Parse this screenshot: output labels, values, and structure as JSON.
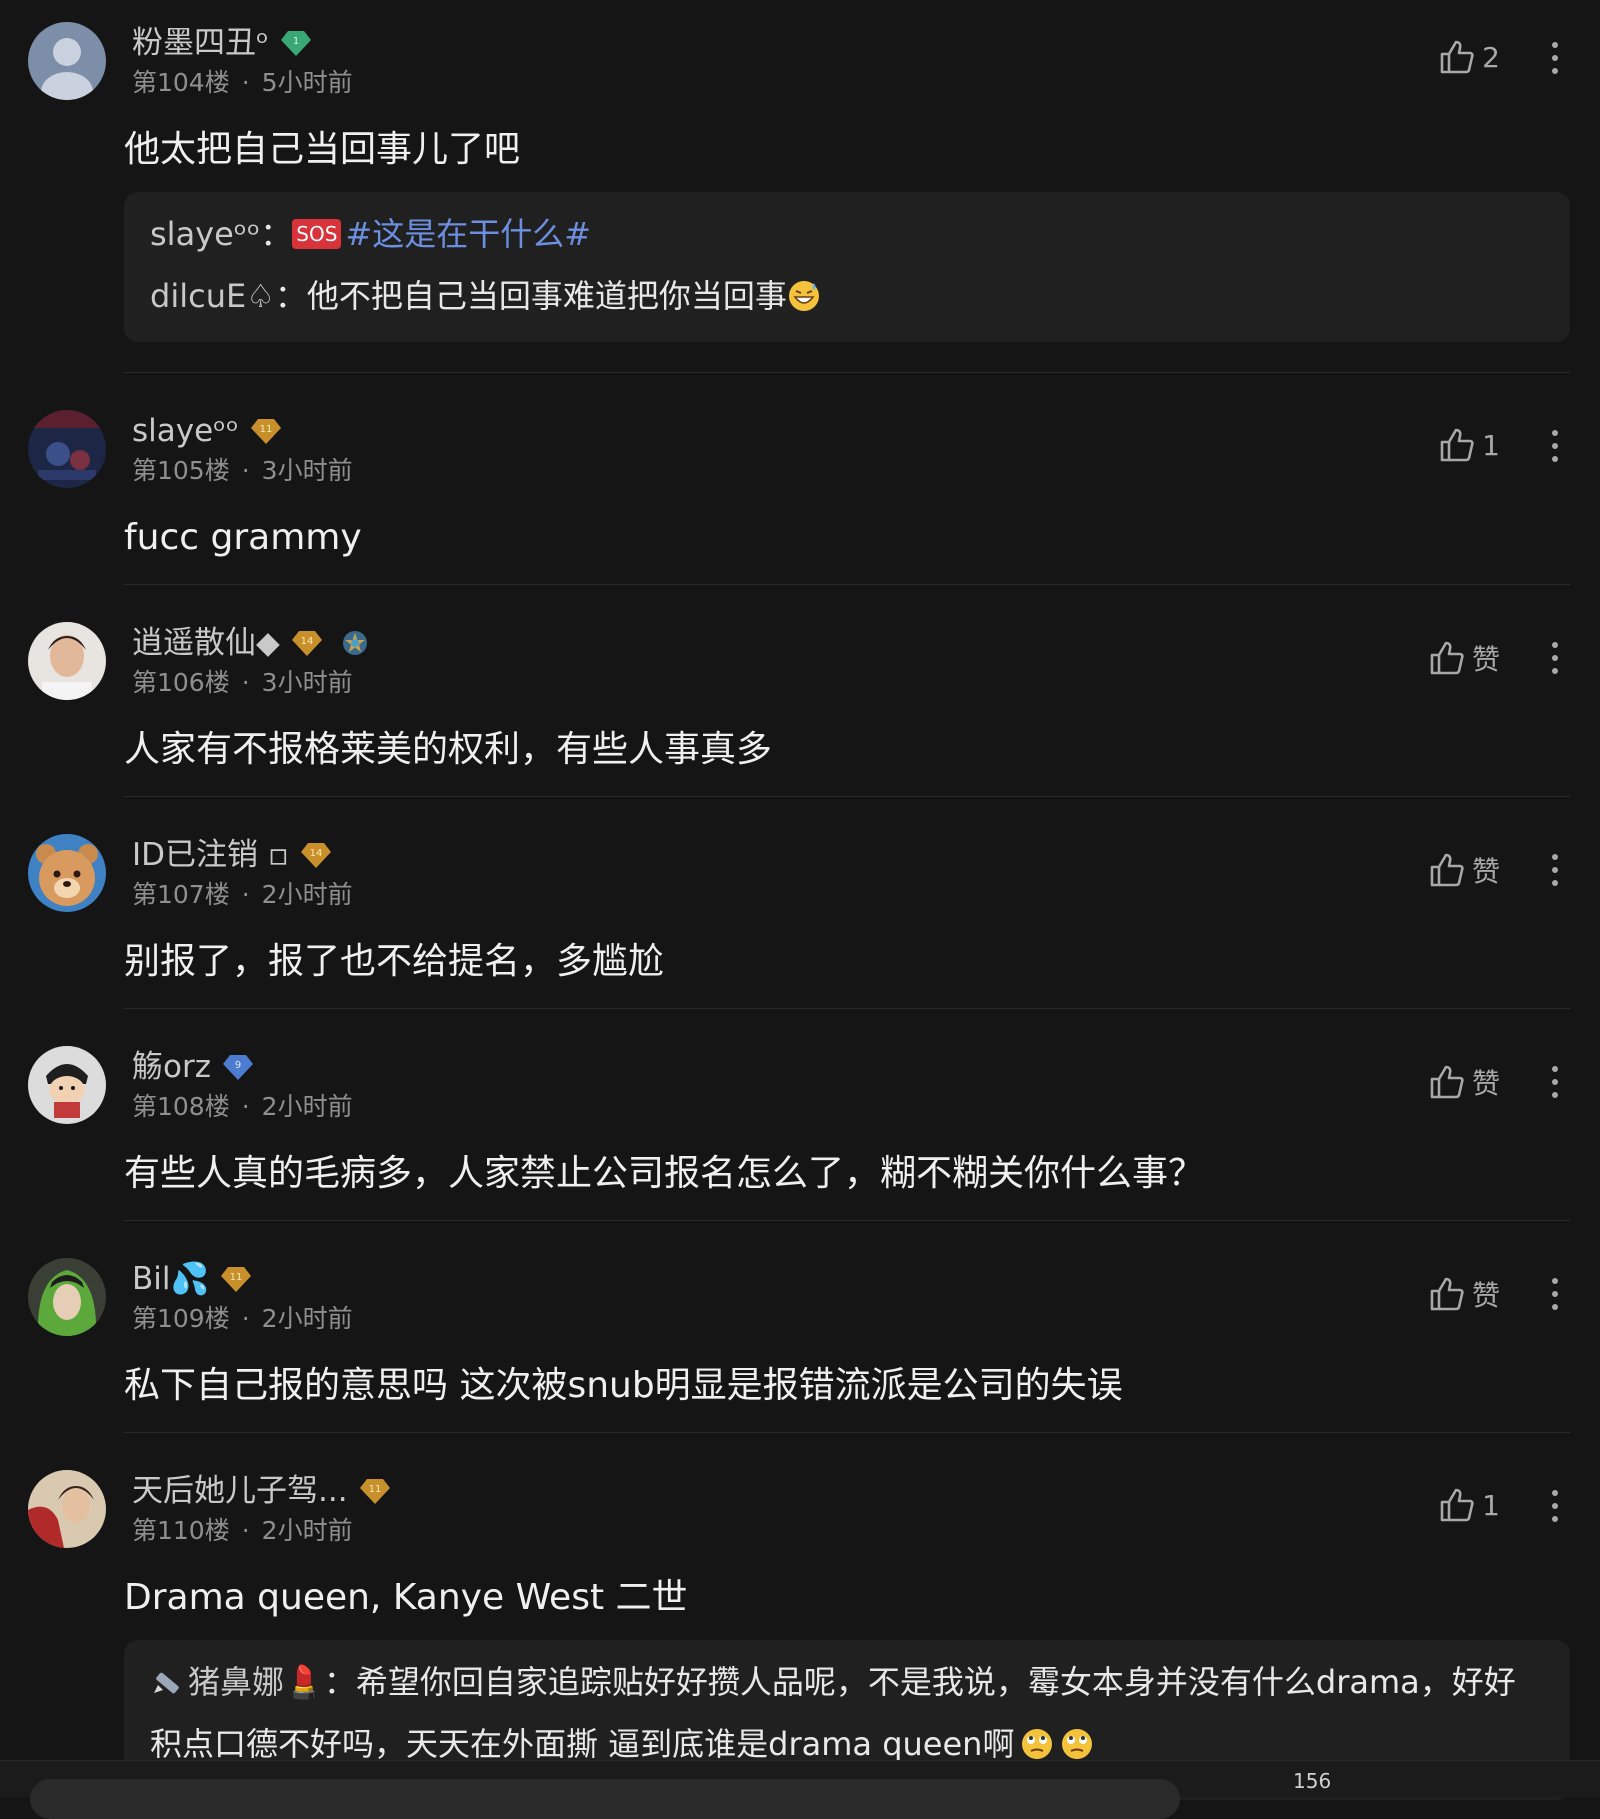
{
  "comments": [
    {
      "username": "粉墨四丑ᵒ",
      "floor": "第104楼",
      "time": "5小时前",
      "like_label": "2",
      "content": "他太把自己当回事儿了吧",
      "badge_level": "1",
      "badge_color": "#3aa876",
      "avatar": "default-user-avatar",
      "replies": [
        {
          "name": "slayeᵒᵒ",
          "sep": "：",
          "sos": "SOS",
          "hashtag": "#这是在干什么#",
          "text": ""
        },
        {
          "name": "dilcuE♤",
          "sep": "：",
          "text": "他不把自己当回事难道把你当回事"
        }
      ]
    },
    {
      "username": "slayeᵒᵒ",
      "floor": "第105楼",
      "time": "3小时前",
      "like_label": "1",
      "content": "fucc grammy",
      "badge_level": "11",
      "badge_color": "#c7902a",
      "avatar": "album-art-avatar"
    },
    {
      "username": "逍遥散仙◆",
      "floor": "第106楼",
      "time": "3小时前",
      "like_label": "赞",
      "content": "人家有不报格莱美的权利，有些人事真多",
      "badge_level": "14",
      "badge_color": "#c7902a",
      "avatar": "photo-avatar"
    },
    {
      "username": "ID已注销 ▫",
      "floor": "第107楼",
      "time": "2小时前",
      "like_label": "赞",
      "content": "别报了，报了也不给提名，多尴尬",
      "badge_level": "14",
      "badge_color": "#c7902a",
      "avatar": "bear-avatar"
    },
    {
      "username": "觞orz",
      "floor": "第108楼",
      "time": "2小时前",
      "like_label": "赞",
      "content": "有些人真的毛病多，人家禁止公司报名怎么了，糊不糊关你什么事？",
      "badge_level": "9",
      "badge_color": "#4c7bd0",
      "avatar": "cartoon-avatar"
    },
    {
      "username": "Bil💦",
      "floor": "第109楼",
      "time": "2小时前",
      "like_label": "赞",
      "content": "私下自己报的意思吗 这次被snub明显是报错流派是公司的失误",
      "badge_level": "11",
      "badge_color": "#c7902a",
      "avatar": "green-hair-avatar"
    },
    {
      "username": "天后她儿子驾...",
      "floor": "第110楼",
      "time": "2小时前",
      "like_label": "1",
      "content": "Drama queen, Kanye West 二世",
      "badge_level": "11",
      "badge_color": "#c7902a",
      "avatar": "red-photo-avatar",
      "replies": [
        {
          "name": "猪鼻娜💄",
          "sep": "：",
          "text": "希望你回自家追踪贴好好攒人品呢，不是我说，霉女本身并没有什么drama，好好"
        },
        {
          "name": "",
          "sep": "",
          "text": "积点口德不好吗，天天在外面撕 逼到底谁是drama queen啊"
        }
      ]
    }
  ],
  "bottom_bar": {
    "count": "156"
  },
  "colors": {
    "background": "#151515",
    "reply_box": "#202020",
    "hashtag": "#6d8fe0"
  }
}
